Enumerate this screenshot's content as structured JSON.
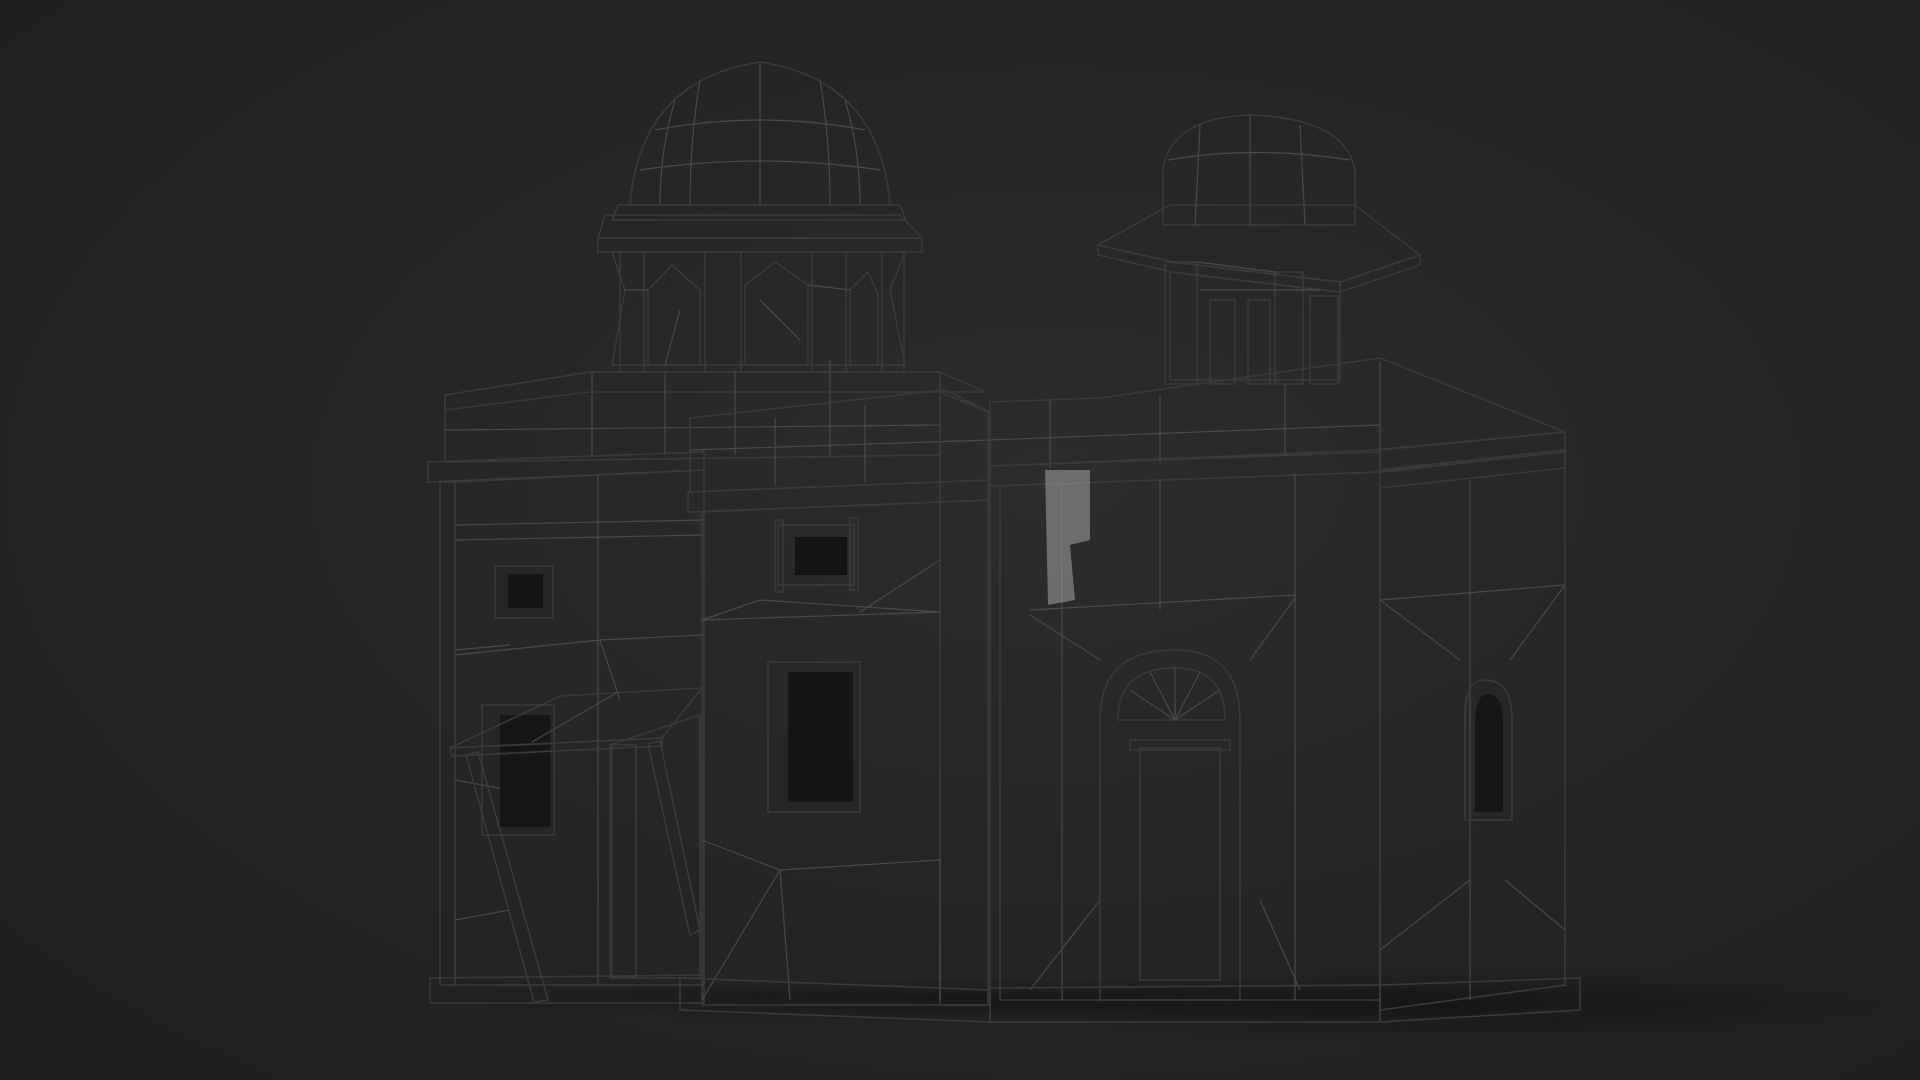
{
  "scene": {
    "subject": "",
    "background_color": "#262626",
    "surface_light": "#c4c4c2",
    "surface_mid": "#a9a9a7",
    "surface_dark": "#8c8c8a",
    "opening_color": "#121212",
    "wire_color": "#4a4a4a"
  }
}
